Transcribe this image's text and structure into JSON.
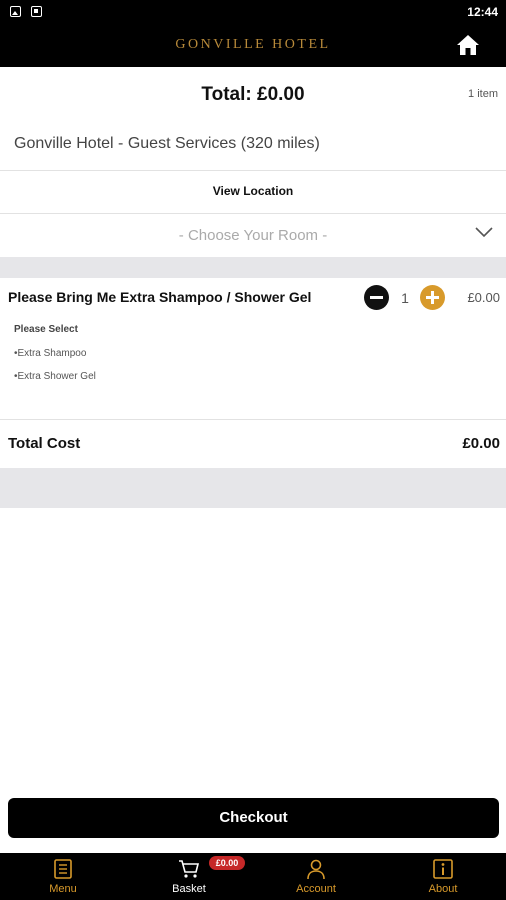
{
  "status_bar": {
    "time": "12:44"
  },
  "header": {
    "brand": "GONVILLE HOTEL"
  },
  "summary": {
    "total": "Total: £0.00",
    "item_count": "1 item"
  },
  "venue": {
    "name": "Gonville Hotel - Guest Services (320 miles)",
    "view_location": "View Location"
  },
  "room_select": {
    "placeholder": "- Choose Your Room -"
  },
  "item": {
    "title": "Please Bring Me Extra Shampoo / Shower Gel",
    "quantity": "1",
    "price": "£0.00",
    "options_heading": "Please Select",
    "options": [
      "•Extra Shampoo",
      "•Extra Shower Gel"
    ]
  },
  "totals": {
    "label": "Total Cost",
    "value": "£0.00"
  },
  "checkout": {
    "label": "Checkout"
  },
  "tabbar": {
    "items": [
      {
        "label": "Menu",
        "icon": "menu-book-icon"
      },
      {
        "label": "Basket",
        "icon": "cart-icon"
      },
      {
        "label": "Account",
        "icon": "person-icon"
      },
      {
        "label": "About",
        "icon": "info-icon"
      }
    ],
    "basket_badge": "£0.00"
  },
  "colors": {
    "accent": "#d89a2b",
    "brand_text": "#b88a3a",
    "badge": "#c62828",
    "band": "#e6e6e9"
  }
}
